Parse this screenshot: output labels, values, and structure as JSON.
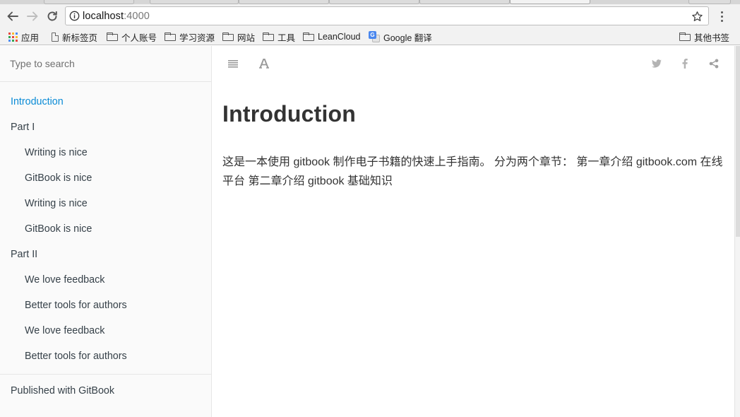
{
  "browser": {
    "url_host": "localhost",
    "url_port": ":4000"
  },
  "bookmarks": [
    {
      "label": "应用",
      "icon": "apps-grid-icon"
    },
    {
      "label": "新标签页",
      "icon": "page-icon"
    },
    {
      "label": "个人账号",
      "icon": "folder-icon"
    },
    {
      "label": "学习资源",
      "icon": "folder-icon"
    },
    {
      "label": "网站",
      "icon": "folder-icon"
    },
    {
      "label": "工具",
      "icon": "folder-icon"
    },
    {
      "label": "LeanCloud",
      "icon": "folder-icon"
    },
    {
      "label": "Google 翻译",
      "icon": "google-translate-icon"
    },
    {
      "label": "其他书签",
      "icon": "folder-icon"
    }
  ],
  "sidebar": {
    "search_placeholder": "Type to search",
    "items": [
      {
        "label": "Introduction",
        "level": 0,
        "active": true
      },
      {
        "label": "Part I",
        "level": 0,
        "active": false
      },
      {
        "label": "Writing is nice",
        "level": 1,
        "active": false
      },
      {
        "label": "GitBook is nice",
        "level": 1,
        "active": false
      },
      {
        "label": "Writing is nice",
        "level": 1,
        "active": false
      },
      {
        "label": "GitBook is nice",
        "level": 1,
        "active": false
      },
      {
        "label": "Part II",
        "level": 0,
        "active": false
      },
      {
        "label": "We love feedback",
        "level": 1,
        "active": false
      },
      {
        "label": "Better tools for authors",
        "level": 1,
        "active": false
      },
      {
        "label": "We love feedback",
        "level": 1,
        "active": false
      },
      {
        "label": "Better tools for authors",
        "level": 1,
        "active": false
      }
    ],
    "footer": "Published with GitBook"
  },
  "content_toolbar": {
    "left": [
      "menu-icon",
      "font-settings-icon"
    ],
    "right": [
      "twitter-icon",
      "facebook-icon",
      "share-icon"
    ]
  },
  "main": {
    "title": "Introduction",
    "body": "这是一本使用 gitbook 制作电子书籍的快速上手指南。 分为两个章节： 第一章介绍 gitbook.com 在线平台 第二章介绍 gitbook 基础知识"
  },
  "colors": {
    "accent": "#0a8bd6",
    "sidebar_bg": "#fafafa",
    "text": "#333333"
  }
}
